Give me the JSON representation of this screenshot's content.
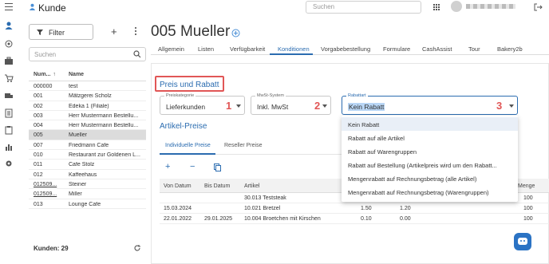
{
  "header": {
    "app_title": "Kunde",
    "search_placeholder": "Suchen"
  },
  "left_panel": {
    "filter_label": "Filter",
    "search_placeholder": "Suchen",
    "columns": [
      "Num...",
      "Name"
    ],
    "rows": [
      {
        "num": "000000",
        "name": "test"
      },
      {
        "num": "001",
        "name": "Mätzgerei Scholz"
      },
      {
        "num": "002",
        "name": "Edeka 1 (Filiale)"
      },
      {
        "num": "003",
        "name": "Herr Mustermann Bestellu..."
      },
      {
        "num": "004",
        "name": "Herr Mustermann Bestellu..."
      },
      {
        "num": "005",
        "name": "Mueller"
      },
      {
        "num": "007",
        "name": "Friedmann Cafe"
      },
      {
        "num": "010",
        "name": "Restaurant zur Goldenen L..."
      },
      {
        "num": "011",
        "name": "Cafe Stolz"
      },
      {
        "num": "012",
        "name": "Kaffeehaus"
      },
      {
        "num": "012509...",
        "name": "Steiner"
      },
      {
        "num": "012509...",
        "name": "Miller"
      },
      {
        "num": "013",
        "name": "Lounge Cafe"
      }
    ],
    "count_label": "Kunden: 29"
  },
  "main": {
    "title": "005 Mueller",
    "tabs": [
      "Allgemein",
      "Listen",
      "Verfügbarkeit",
      "Konditionen",
      "Vorgabebestellung",
      "Formulare",
      "CashAssist",
      "Tour",
      "Bakery2b"
    ],
    "active_tab": "Konditionen",
    "section_title": "Preis und Rabatt",
    "fields": {
      "preiskategorie": {
        "label": "Preiskategorie",
        "value": "Lieferkunden",
        "marker": "1"
      },
      "mwst": {
        "label": "MwSt-System",
        "value": "Inkl. MwSt",
        "marker": "2"
      },
      "rabattart": {
        "label": "Rabattart",
        "value": "Kein Rabatt",
        "marker": "3"
      }
    },
    "article_prices_title": "Artikel-Preise",
    "sub_tabs": [
      "Individuelle Preise",
      "Reseller Preise"
    ],
    "grid_columns": [
      "Von Datum",
      "Bis Datum",
      "Artikel",
      "Menge"
    ],
    "grid_rows": [
      {
        "von": "",
        "bis": "",
        "artikel": "30.013 Teststeak",
        "p1": "",
        "p2": "",
        "menge": "100"
      },
      {
        "von": "15.03.2024",
        "bis": "",
        "artikel": "10.021 Bretzel",
        "p1": "1.50",
        "p2": "1.20",
        "menge": "100"
      },
      {
        "von": "22.01.2022",
        "bis": "29.01.2025",
        "artikel": "10.004 Broetchen mit Kirschen",
        "p1": "0.10",
        "p2": "0.00",
        "menge": "100"
      }
    ],
    "dropdown_options": [
      "Kein Rabatt",
      "Rabatt auf alle Artikel",
      "Rabatt auf Warengruppen",
      "Rabatt auf Bestellung (Artikelpreis wird um den Rabatt...",
      "Mengenrabatt auf Rechnungsbetrag (alle Artikel)",
      "Mengenrabatt auf Rechnungsbetrag (Warengruppen)"
    ]
  },
  "colors": {
    "accent": "#2b6cb0",
    "highlight_box": "#e15656",
    "selected_row": "#dcdcdc"
  },
  "icons": [
    "menu-icon",
    "user-icon",
    "grid-icon",
    "logout-icon",
    "filter-icon",
    "search-icon",
    "refresh-icon",
    "settings-icon",
    "add-icon",
    "remove-icon",
    "copy-icon",
    "chat-icon"
  ]
}
